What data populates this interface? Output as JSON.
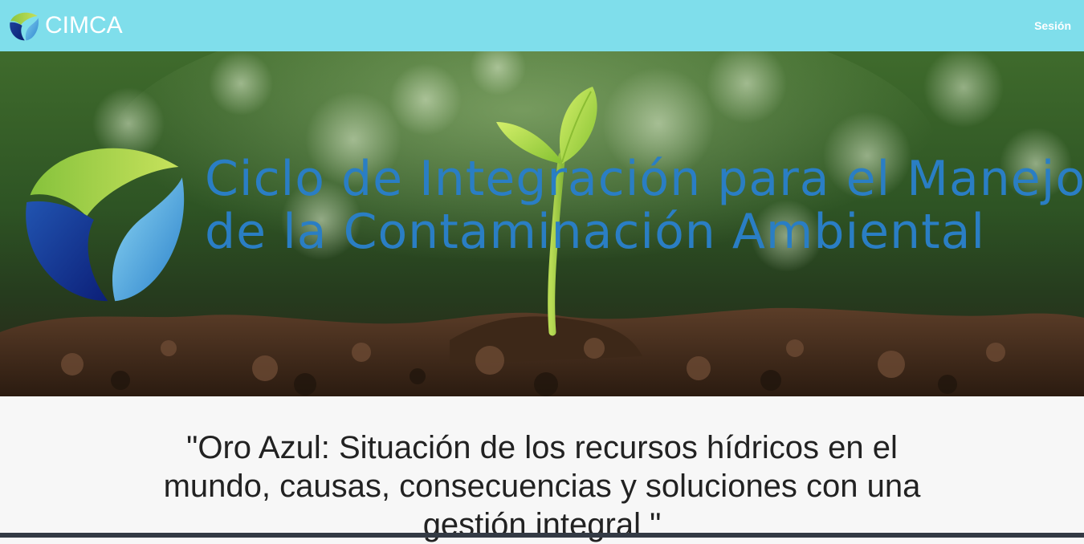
{
  "navbar": {
    "brand": "CIMCA",
    "session_label": "Sesión",
    "bg_color": "#7fdeeb"
  },
  "hero": {
    "title_line1": "Ciclo de Integración para el Manejo",
    "title_line2": "de la Contaminación Ambiental",
    "title_color": "#2a7ec4",
    "image_subject": "seedling-sprouting-from-soil"
  },
  "talk": {
    "title": "\"Oro Azul: Situación de los recursos hídricos en el mundo, causas, consecuencias y soluciones con una gestión integral \""
  },
  "icons": {
    "brand_logo": "cimca-logo-icon",
    "hero_logo": "cimca-large-logo-icon"
  }
}
